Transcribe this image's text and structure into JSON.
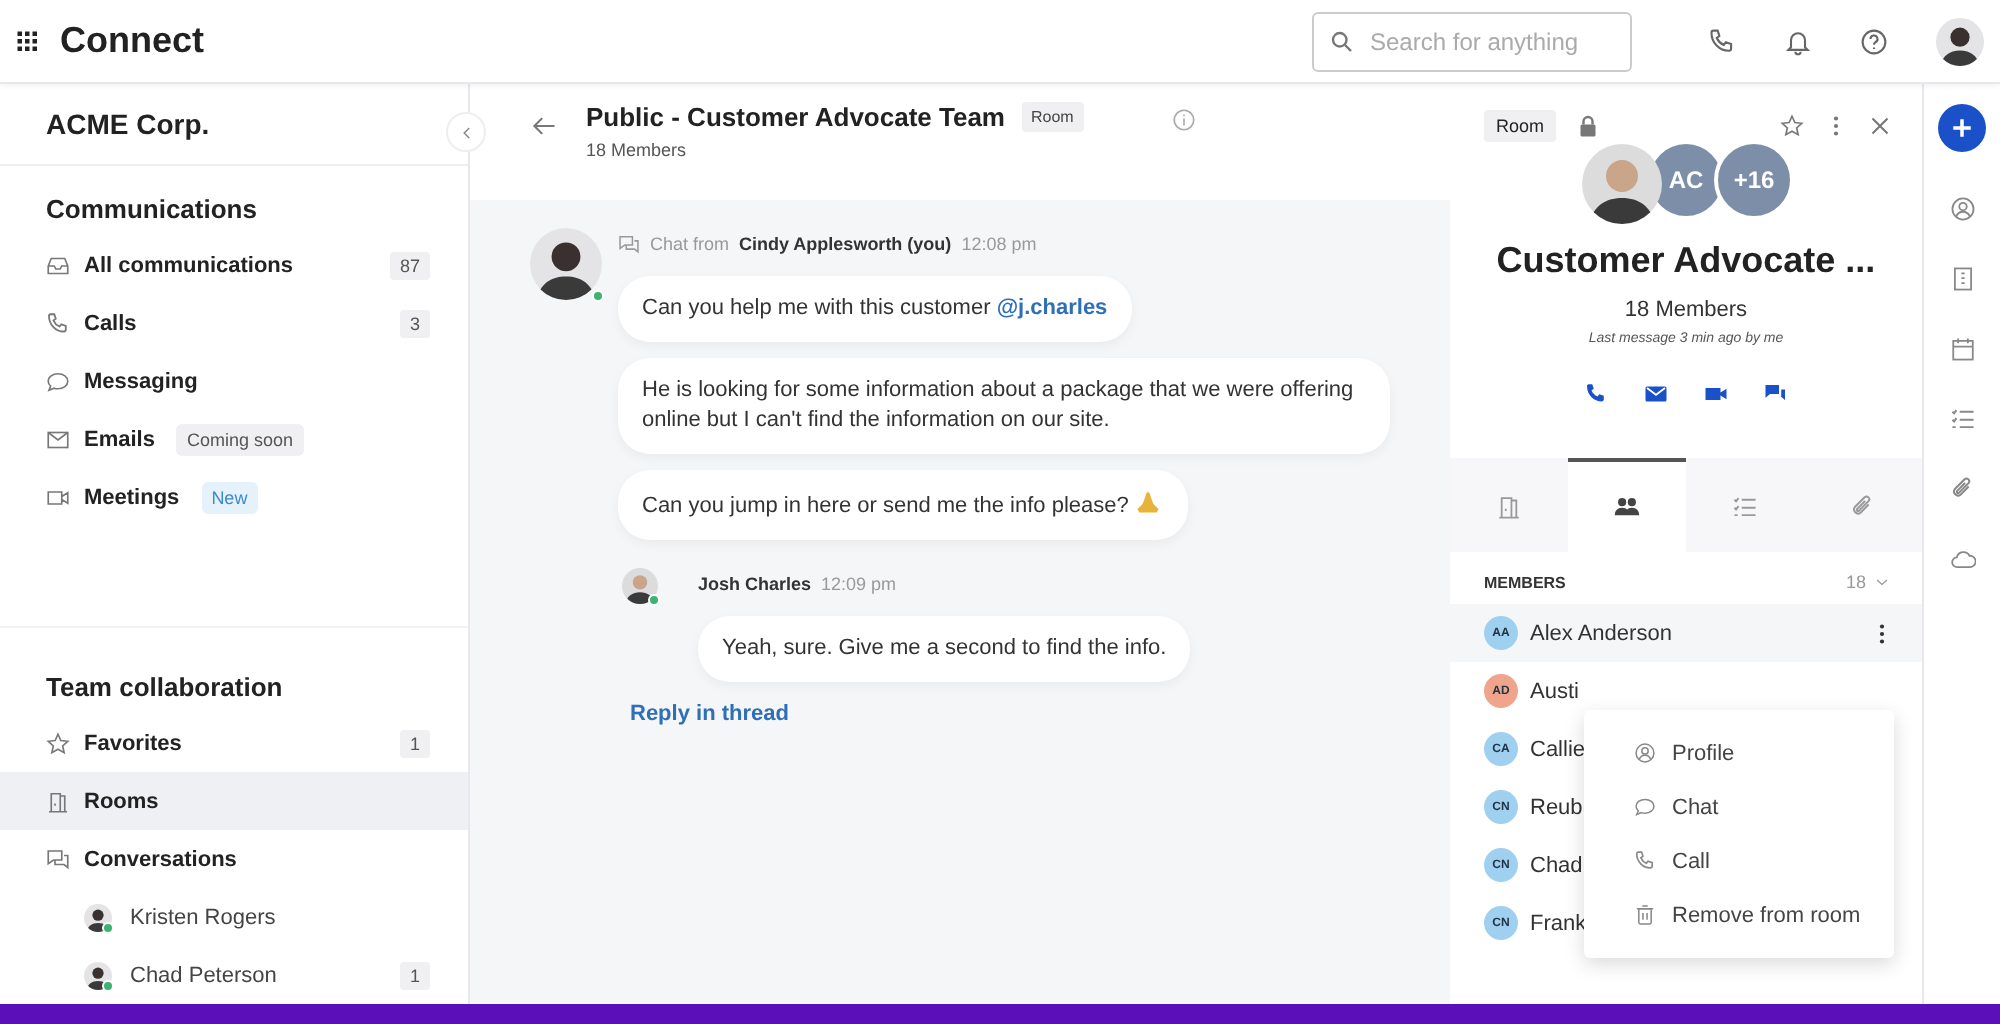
{
  "app": {
    "title": "Connect",
    "search": {
      "placeholder": "Search for anything"
    }
  },
  "sidebar": {
    "org": "ACME Corp.",
    "sections": [
      {
        "title": "Communications",
        "items": [
          {
            "label": "All communications",
            "count": "87",
            "selected": false
          },
          {
            "label": "Calls",
            "count": "3",
            "selected": false
          },
          {
            "label": "Messaging",
            "selected": false
          },
          {
            "label": "Emails",
            "tag": {
              "text": "Coming soon",
              "kind": "soon"
            },
            "selected": false
          },
          {
            "label": "Meetings",
            "tag": {
              "text": "New",
              "kind": "new"
            },
            "selected": false
          }
        ]
      },
      {
        "title": "Team collaboration",
        "items": [
          {
            "label": "Favorites",
            "count": "1",
            "selected": false
          },
          {
            "label": "Rooms",
            "selected": true
          },
          {
            "label": "Conversations",
            "selected": false,
            "children": [
              {
                "label": "Kristen Rogers",
                "online": true,
                "selected": false
              },
              {
                "label": "Chad Peterson",
                "online": true,
                "count": "1",
                "selected": false
              }
            ]
          }
        ]
      }
    ]
  },
  "chat": {
    "title": "Public - Customer Advocate Team",
    "tag": "Room",
    "subtitle": "18 Members",
    "messages": [
      {
        "source": "Chat from",
        "author": "Cindy Applesworth (you)",
        "time": "12:08 pm",
        "online": true,
        "bubbles": [
          {
            "text": "Can you help me with this customer ",
            "mention": "@j.charles"
          },
          {
            "text": "He is looking for some information about a package that we were offering online but I can't find the information on our site."
          },
          {
            "text": "Can you jump in here or send me the info please?",
            "emoji": true
          }
        ],
        "reply": {
          "author": "Josh Charles",
          "time": "12:09 pm",
          "online": true,
          "bubbles": [
            {
              "text": "Yeah, sure. Give me a second to find the info."
            }
          ]
        }
      }
    ],
    "reply_link": "Reply in thread"
  },
  "panel": {
    "tag": "Room",
    "locked": true,
    "avatars": [
      {
        "kind": "picture"
      },
      {
        "kind": "initials",
        "text": "AC"
      },
      {
        "kind": "count",
        "text": "+16"
      }
    ],
    "title": "Customer Advocate ...",
    "members_label": "18 Members",
    "last_message": "Last message 3 min ago by me",
    "tabs": [
      {
        "selected": false
      },
      {
        "selected": true
      },
      {
        "selected": false
      },
      {
        "selected": false
      }
    ],
    "members_header": "MEMBERS",
    "members_count": "18",
    "members": [
      {
        "initials": "AA",
        "name": "Alex Anderson",
        "color": "#9fd0f0",
        "hovered": true
      },
      {
        "initials": "AD",
        "name": "Austi",
        "color": "#f0a48c"
      },
      {
        "initials": "CA",
        "name": "Callie",
        "color": "#9fd0f0"
      },
      {
        "initials": "CN",
        "name": "Reub",
        "color": "#9fd0f0"
      },
      {
        "initials": "CN",
        "name": "Chad",
        "color": "#9fd0f0"
      },
      {
        "initials": "CN",
        "name": "Frank",
        "color": "#9fd0f0"
      }
    ],
    "menu": [
      {
        "label": "Profile"
      },
      {
        "label": "Chat"
      },
      {
        "label": "Call"
      },
      {
        "label": "Remove from room"
      }
    ]
  }
}
